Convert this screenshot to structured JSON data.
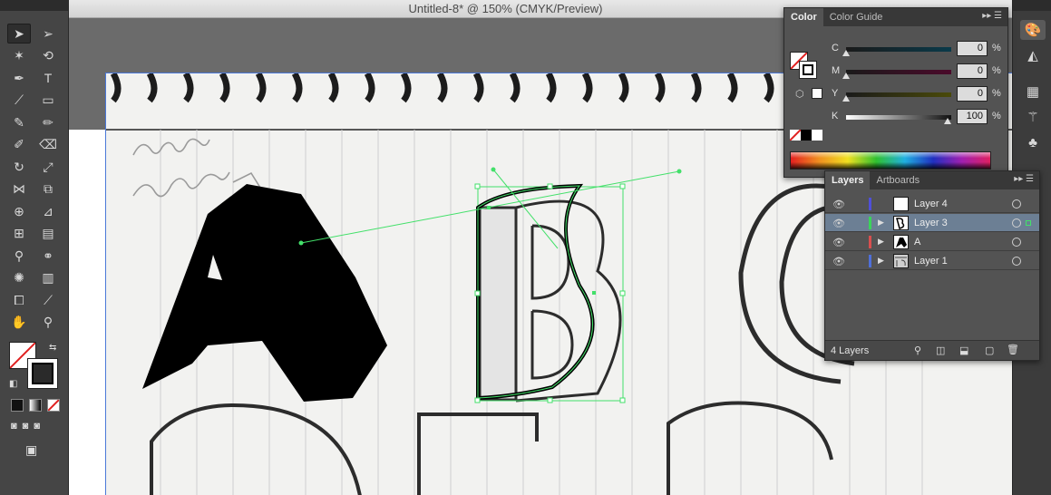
{
  "window": {
    "title": "Untitled-8* @ 150% (CMYK/Preview)"
  },
  "tools": [
    {
      "name": "selection-tool",
      "glyph": "➤",
      "active": true
    },
    {
      "name": "direct-selection-tool",
      "glyph": "➢"
    },
    {
      "name": "magic-wand-tool",
      "glyph": "✶"
    },
    {
      "name": "lasso-tool",
      "glyph": "⟲"
    },
    {
      "name": "pen-tool",
      "glyph": "✒"
    },
    {
      "name": "type-tool",
      "glyph": "T"
    },
    {
      "name": "line-segment-tool",
      "glyph": "⟋"
    },
    {
      "name": "rectangle-tool",
      "glyph": "▭"
    },
    {
      "name": "paintbrush-tool",
      "glyph": "✎"
    },
    {
      "name": "pencil-tool",
      "glyph": "✏"
    },
    {
      "name": "blob-brush-tool",
      "glyph": "✐"
    },
    {
      "name": "eraser-tool",
      "glyph": "⌫"
    },
    {
      "name": "rotate-tool",
      "glyph": "↻"
    },
    {
      "name": "scale-tool",
      "glyph": "⤢"
    },
    {
      "name": "width-tool",
      "glyph": "⋈"
    },
    {
      "name": "free-transform-tool",
      "glyph": "⧉"
    },
    {
      "name": "shape-builder-tool",
      "glyph": "⊕"
    },
    {
      "name": "perspective-grid-tool",
      "glyph": "⊿"
    },
    {
      "name": "mesh-tool",
      "glyph": "⊞"
    },
    {
      "name": "gradient-tool",
      "glyph": "▤"
    },
    {
      "name": "eyedropper-tool",
      "glyph": "⚲"
    },
    {
      "name": "blend-tool",
      "glyph": "⚭"
    },
    {
      "name": "symbol-sprayer-tool",
      "glyph": "✺"
    },
    {
      "name": "column-graph-tool",
      "glyph": "▥"
    },
    {
      "name": "artboard-tool",
      "glyph": "⧠"
    },
    {
      "name": "slice-tool",
      "glyph": "⟋"
    },
    {
      "name": "hand-tool",
      "glyph": "✋"
    },
    {
      "name": "zoom-tool",
      "glyph": "⚲"
    }
  ],
  "dock": [
    "swatches-icon",
    "gradient-icon",
    "transparency-icon",
    "brushes-icon",
    "symbols-icon"
  ],
  "color_panel": {
    "tabs": [
      "Color",
      "Color Guide"
    ],
    "active_tab": "Color",
    "channels": [
      {
        "label": "C",
        "value": "0",
        "unit": "%",
        "gradient": "linear-gradient(90deg,#1a1a1a,#0a3a4a)",
        "fill": 0.0
      },
      {
        "label": "M",
        "value": "0",
        "unit": "%",
        "gradient": "linear-gradient(90deg,#1a1a1a,#4a0a2a)",
        "fill": 0.0
      },
      {
        "label": "Y",
        "value": "0",
        "unit": "%",
        "gradient": "linear-gradient(90deg,#1a1a1a,#4a4a0a)",
        "fill": 0.0
      },
      {
        "label": "K",
        "value": "100",
        "unit": "%",
        "gradient": "linear-gradient(90deg,#ffffff,#111111)",
        "fill": 1.0
      }
    ]
  },
  "layers_panel": {
    "tabs": [
      "Layers",
      "Artboards"
    ],
    "active_tab": "Layers",
    "layers": [
      {
        "name": "Layer 4",
        "color": "#4f4fd9",
        "selected": false,
        "thumb": "blank"
      },
      {
        "name": "Layer 3",
        "color": "#3bd45a",
        "selected": true,
        "thumb": "path"
      },
      {
        "name": "A",
        "color": "#d94f4f",
        "selected": false,
        "thumb": "letter"
      },
      {
        "name": "Layer 1",
        "color": "#4f6fd9",
        "selected": false,
        "thumb": "image"
      }
    ],
    "count_label": "4 Layers"
  },
  "artwork": {
    "sketch_note": "comes\nof one point"
  }
}
